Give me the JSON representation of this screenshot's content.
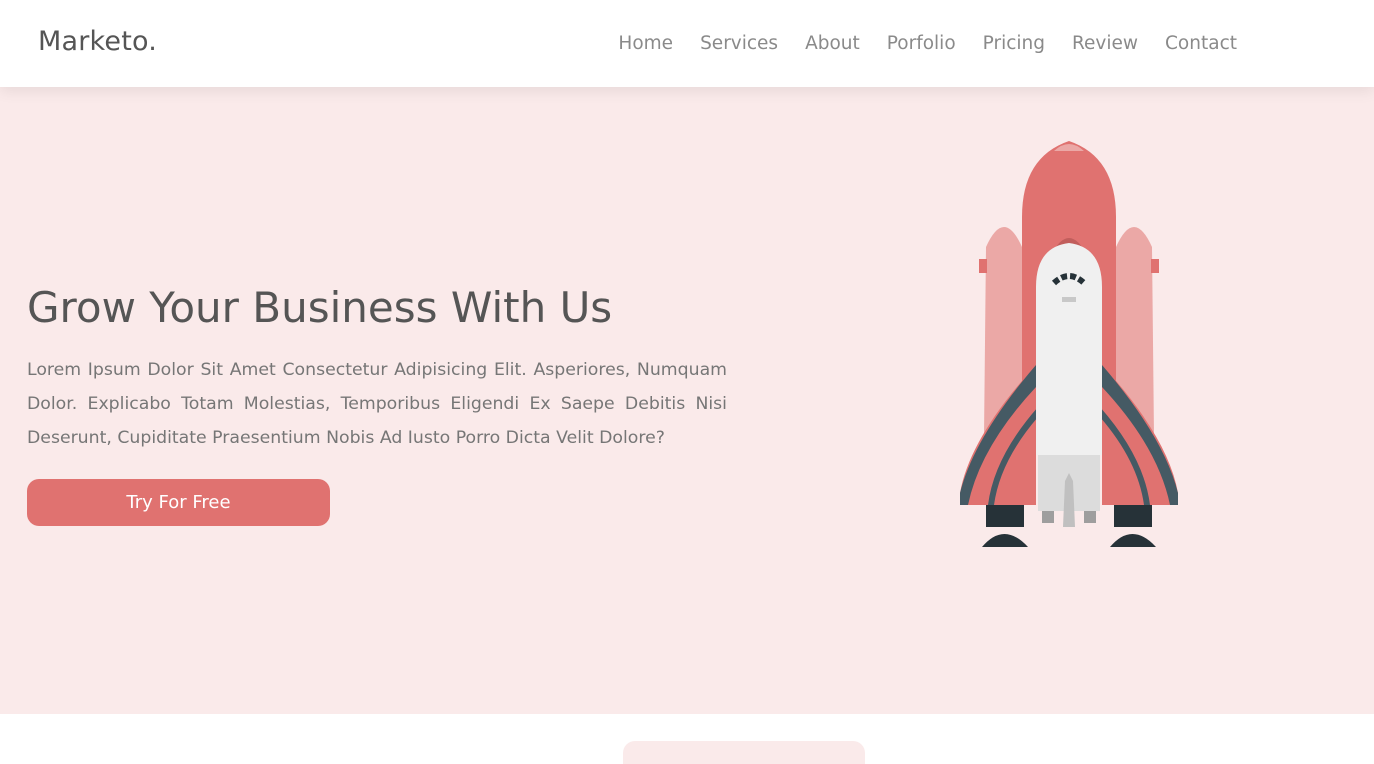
{
  "brand": {
    "logo_text": "Marketo."
  },
  "nav": {
    "items": [
      {
        "label": "Home"
      },
      {
        "label": "Services"
      },
      {
        "label": "About"
      },
      {
        "label": "Porfolio"
      },
      {
        "label": "Pricing"
      },
      {
        "label": "Review"
      },
      {
        "label": "Contact"
      }
    ]
  },
  "hero": {
    "title": "Grow Your Business With Us",
    "description": "Lorem Ipsum Dolor Sit Amet Consectetur Adipisicing Elit. Asperiores, Numquam Dolor. Explicabo Totam Molestias, Temporibus Eligendi Ex Saepe Debitis Nisi Deserunt, Cupiditate Praesentium Nobis Ad Iusto Porro Dicta Velit Dolore?",
    "cta_label": "Try For Free",
    "illustration": "rocket-illustration"
  },
  "colors": {
    "accent": "#e07270",
    "hero_background": "#faeaea",
    "text_dark": "#555555",
    "nav_text": "#8a8a8a"
  }
}
